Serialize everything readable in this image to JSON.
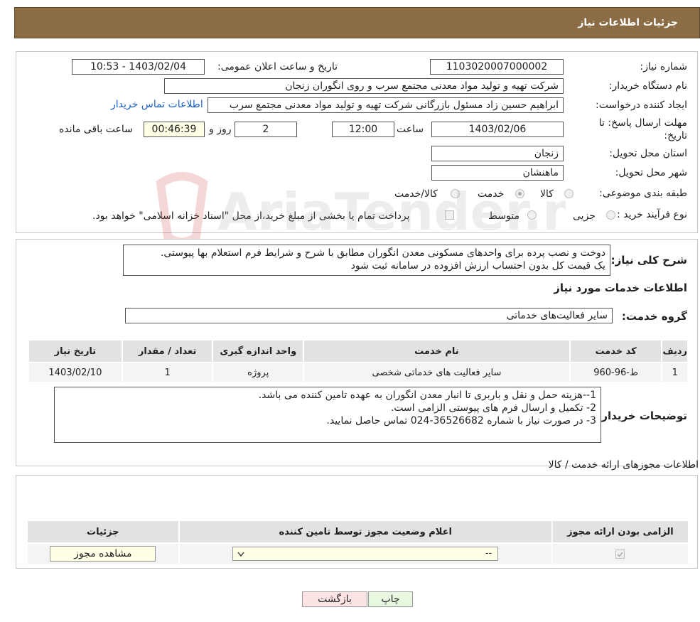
{
  "header": {
    "title": "جزئیات اطلاعات نیاز"
  },
  "need": {
    "need_number_label": "شماره نیاز:",
    "need_number": "1103020007000002",
    "announce_label": "تاریخ و ساعت اعلان عمومی:",
    "announce_value": "1403/02/04 - 10:53",
    "buyer_org_label": "نام دستگاه خریدار:",
    "buyer_org": "شرکت تهیه و تولید مواد معدنی مجتمع سرب و روی انگوران   زنجان",
    "creator_label": "ایجاد کننده درخواست:",
    "creator": "ابراهیم حسین زاد مسئول بازرگانی شرکت تهیه و تولید مواد معدنی مجتمع سرب",
    "contact_link": "اطلاعات تماس خریدار",
    "deadline_label": "مهلت ارسال پاسخ: تا تاریخ:",
    "deadline_date": "1403/02/06",
    "time_label": "ساعت",
    "deadline_time": "12:00",
    "days_value": "2",
    "days_label": "روز و",
    "remaining_time": "00:46:39",
    "remaining_label": "ساعت باقی مانده",
    "province_label": "استان محل تحویل:",
    "province": "زنجان",
    "city_label": "شهر محل تحویل:",
    "city": "ماهنشان",
    "category_label": "طبقه بندی موضوعی:",
    "category_options": [
      "کالا",
      "خدمت",
      "کالا/خدمت"
    ],
    "category_selected": "خدمت",
    "process_label": "نوع فرآیند خرید :",
    "process_options": [
      "جزیی",
      "متوسط"
    ],
    "payment_note": "پرداخت تمام یا بخشی از مبلغ خرید،از محل \"اسناد خزانه اسلامی\" خواهد بود."
  },
  "summary": {
    "label": "شرح کلی نیاز:",
    "text_line1": "دوخت و نصب پرده برای واحدهای مسکونی معدن انگوران مطابق با شرح و شرایط فرم استعلام بها پیوستی.",
    "text_line2": "یک قیمت کل بدون احتساب ارزش افزوده در سامانه ثبت شود"
  },
  "services": {
    "section_title": "اطلاعات خدمات مورد نیاز",
    "group_label": "گروه خدمت:",
    "group_value": "سایر فعالیت‌های خدماتی",
    "columns": [
      "ردیف",
      "کد خدمت",
      "نام خدمت",
      "واحد اندازه گیری",
      "تعداد / مقدار",
      "تاریخ نیاز"
    ],
    "rows": [
      [
        "1",
        "ط-96-960",
        "سایر فعالیت های خدماتی شخصی",
        "پروژه",
        "1",
        "1403/02/10"
      ]
    ]
  },
  "buyer_notes": {
    "label": "توضیحات خریدار:",
    "line1": "1--هزینه حمل و نقل و باربری تا انبار معدن انگوران به عهده تامین کننده می باشد.",
    "line2": "2- تکمیل و ارسال فرم های پیوستی الزامی است.",
    "line3": "3- در صورت نیاز با شماره 36526682-024 تماس حاصل نمایید."
  },
  "licenses": {
    "section_title": "اطلاعات مجوزهای ارائه خدمت / کالا",
    "columns": [
      "الزامی بودن ارائه مجوز",
      "اعلام وضعیت مجوز توسط تامین کننده",
      "جزئیات"
    ],
    "select_value": "--",
    "view_button": "مشاهده مجوز"
  },
  "actions": {
    "back": "بازگشت",
    "print": "چاپ"
  },
  "watermark": {
    "text": "AriaTender.neT"
  },
  "colors": {
    "titlebar": "#8b6c45",
    "link": "#1a5fc9",
    "print_bg": "#e8f8e0",
    "back_bg": "#fde4e4"
  }
}
